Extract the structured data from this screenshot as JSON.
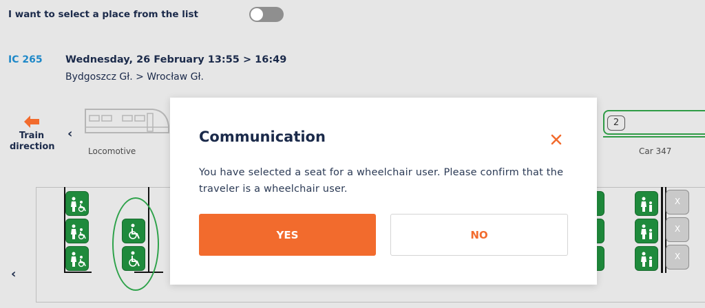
{
  "settings": {
    "select_from_list_label": "I want to select a place from the list",
    "select_from_list_enabled": false
  },
  "journey": {
    "train_number": "IC 265",
    "date_time": "Wednesday, 26 February 13:55 > 16:49",
    "route": "Bydgoszcz Gł. > Wrocław Gł."
  },
  "train_strip": {
    "direction_label_line1": "Train",
    "direction_label_line2": "direction",
    "prev_glyph": "‹",
    "locomotive_label": "Locomotive",
    "car_class": "2",
    "car_label": "Car 347"
  },
  "seat_map": {
    "prev_glyph": "‹",
    "unavailable_glyph": "X"
  },
  "dialog": {
    "title": "Communication",
    "message": "You have selected a seat for a wheelchair user. Please confirm that the traveler is a wheelchair user.",
    "yes_label": "YES",
    "no_label": "NO",
    "close_icon": "close-icon"
  },
  "colors": {
    "accent_orange": "#f26b2d",
    "link_blue": "#1e88c8",
    "seat_green": "#1f8a3c",
    "highlight_green": "#2ea24a",
    "navy_text": "#1b2a4a"
  }
}
